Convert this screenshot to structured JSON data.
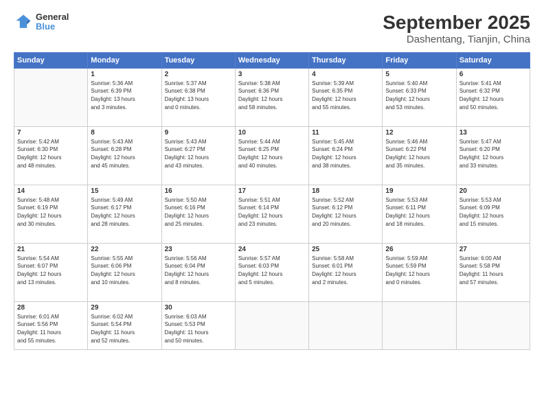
{
  "header": {
    "logo_line1": "General",
    "logo_line2": "Blue",
    "title": "September 2025",
    "subtitle": "Dashentang, Tianjin, China"
  },
  "weekdays": [
    "Sunday",
    "Monday",
    "Tuesday",
    "Wednesday",
    "Thursday",
    "Friday",
    "Saturday"
  ],
  "weeks": [
    [
      {
        "day": "",
        "info": ""
      },
      {
        "day": "1",
        "info": "Sunrise: 5:36 AM\nSunset: 6:39 PM\nDaylight: 13 hours\nand 3 minutes."
      },
      {
        "day": "2",
        "info": "Sunrise: 5:37 AM\nSunset: 6:38 PM\nDaylight: 13 hours\nand 0 minutes."
      },
      {
        "day": "3",
        "info": "Sunrise: 5:38 AM\nSunset: 6:36 PM\nDaylight: 12 hours\nand 58 minutes."
      },
      {
        "day": "4",
        "info": "Sunrise: 5:39 AM\nSunset: 6:35 PM\nDaylight: 12 hours\nand 55 minutes."
      },
      {
        "day": "5",
        "info": "Sunrise: 5:40 AM\nSunset: 6:33 PM\nDaylight: 12 hours\nand 53 minutes."
      },
      {
        "day": "6",
        "info": "Sunrise: 5:41 AM\nSunset: 6:32 PM\nDaylight: 12 hours\nand 50 minutes."
      }
    ],
    [
      {
        "day": "7",
        "info": "Sunrise: 5:42 AM\nSunset: 6:30 PM\nDaylight: 12 hours\nand 48 minutes."
      },
      {
        "day": "8",
        "info": "Sunrise: 5:43 AM\nSunset: 6:28 PM\nDaylight: 12 hours\nand 45 minutes."
      },
      {
        "day": "9",
        "info": "Sunrise: 5:43 AM\nSunset: 6:27 PM\nDaylight: 12 hours\nand 43 minutes."
      },
      {
        "day": "10",
        "info": "Sunrise: 5:44 AM\nSunset: 6:25 PM\nDaylight: 12 hours\nand 40 minutes."
      },
      {
        "day": "11",
        "info": "Sunrise: 5:45 AM\nSunset: 6:24 PM\nDaylight: 12 hours\nand 38 minutes."
      },
      {
        "day": "12",
        "info": "Sunrise: 5:46 AM\nSunset: 6:22 PM\nDaylight: 12 hours\nand 35 minutes."
      },
      {
        "day": "13",
        "info": "Sunrise: 5:47 AM\nSunset: 6:20 PM\nDaylight: 12 hours\nand 33 minutes."
      }
    ],
    [
      {
        "day": "14",
        "info": "Sunrise: 5:48 AM\nSunset: 6:19 PM\nDaylight: 12 hours\nand 30 minutes."
      },
      {
        "day": "15",
        "info": "Sunrise: 5:49 AM\nSunset: 6:17 PM\nDaylight: 12 hours\nand 28 minutes."
      },
      {
        "day": "16",
        "info": "Sunrise: 5:50 AM\nSunset: 6:16 PM\nDaylight: 12 hours\nand 25 minutes."
      },
      {
        "day": "17",
        "info": "Sunrise: 5:51 AM\nSunset: 6:14 PM\nDaylight: 12 hours\nand 23 minutes."
      },
      {
        "day": "18",
        "info": "Sunrise: 5:52 AM\nSunset: 6:12 PM\nDaylight: 12 hours\nand 20 minutes."
      },
      {
        "day": "19",
        "info": "Sunrise: 5:53 AM\nSunset: 6:11 PM\nDaylight: 12 hours\nand 18 minutes."
      },
      {
        "day": "20",
        "info": "Sunrise: 5:53 AM\nSunset: 6:09 PM\nDaylight: 12 hours\nand 15 minutes."
      }
    ],
    [
      {
        "day": "21",
        "info": "Sunrise: 5:54 AM\nSunset: 6:07 PM\nDaylight: 12 hours\nand 13 minutes."
      },
      {
        "day": "22",
        "info": "Sunrise: 5:55 AM\nSunset: 6:06 PM\nDaylight: 12 hours\nand 10 minutes."
      },
      {
        "day": "23",
        "info": "Sunrise: 5:56 AM\nSunset: 6:04 PM\nDaylight: 12 hours\nand 8 minutes."
      },
      {
        "day": "24",
        "info": "Sunrise: 5:57 AM\nSunset: 6:03 PM\nDaylight: 12 hours\nand 5 minutes."
      },
      {
        "day": "25",
        "info": "Sunrise: 5:58 AM\nSunset: 6:01 PM\nDaylight: 12 hours\nand 2 minutes."
      },
      {
        "day": "26",
        "info": "Sunrise: 5:59 AM\nSunset: 5:59 PM\nDaylight: 12 hours\nand 0 minutes."
      },
      {
        "day": "27",
        "info": "Sunrise: 6:00 AM\nSunset: 5:58 PM\nDaylight: 11 hours\nand 57 minutes."
      }
    ],
    [
      {
        "day": "28",
        "info": "Sunrise: 6:01 AM\nSunset: 5:56 PM\nDaylight: 11 hours\nand 55 minutes."
      },
      {
        "day": "29",
        "info": "Sunrise: 6:02 AM\nSunset: 5:54 PM\nDaylight: 11 hours\nand 52 minutes."
      },
      {
        "day": "30",
        "info": "Sunrise: 6:03 AM\nSunset: 5:53 PM\nDaylight: 11 hours\nand 50 minutes."
      },
      {
        "day": "",
        "info": ""
      },
      {
        "day": "",
        "info": ""
      },
      {
        "day": "",
        "info": ""
      },
      {
        "day": "",
        "info": ""
      }
    ]
  ]
}
